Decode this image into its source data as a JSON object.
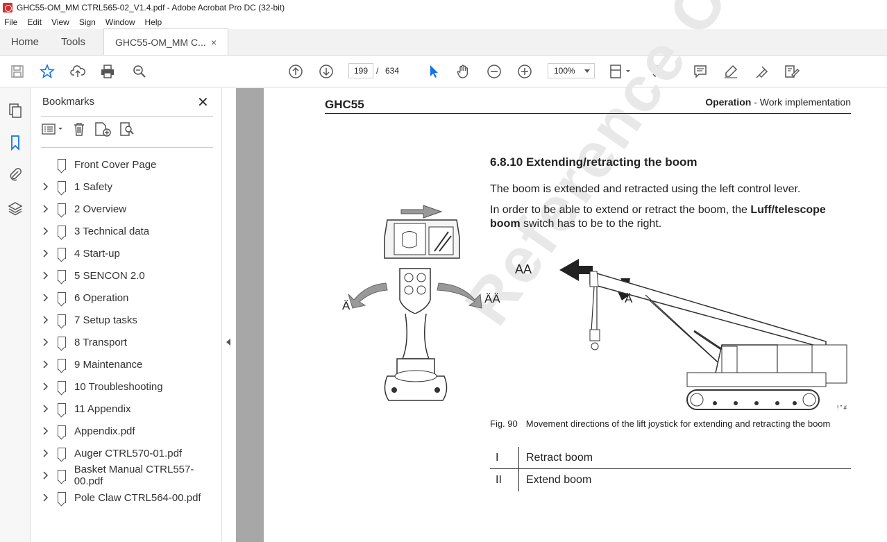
{
  "window": {
    "title": "GHC55-OM_MM CTRL565-02_V1.4.pdf - Adobe Acrobat Pro DC (32-bit)"
  },
  "menu": [
    "File",
    "Edit",
    "View",
    "Sign",
    "Window",
    "Help"
  ],
  "tabs": {
    "home": "Home",
    "tools": "Tools",
    "doc": "GHC55-OM_MM C...",
    "close": "×"
  },
  "toolbar": {
    "page_current": "199",
    "page_sep": "/",
    "page_total": "634",
    "zoom": "100%"
  },
  "bookmarks": {
    "title": "Bookmarks",
    "close": "✕",
    "items": [
      {
        "label": "Front Cover Page",
        "expandable": false
      },
      {
        "label": "1 Safety",
        "expandable": true
      },
      {
        "label": "2 Overview",
        "expandable": true
      },
      {
        "label": "3 Technical data",
        "expandable": true
      },
      {
        "label": "4 Start-up",
        "expandable": true
      },
      {
        "label": "5 SENCON 2.0",
        "expandable": true
      },
      {
        "label": "6 Operation",
        "expandable": true
      },
      {
        "label": "7 Setup tasks",
        "expandable": true
      },
      {
        "label": "8 Transport",
        "expandable": true
      },
      {
        "label": "9 Maintenance",
        "expandable": true
      },
      {
        "label": "10 Troubleshooting",
        "expandable": true
      },
      {
        "label": "11 Appendix",
        "expandable": true
      },
      {
        "label": " Appendix.pdf",
        "expandable": true
      },
      {
        "label": "Auger CTRL570-01.pdf",
        "expandable": true
      },
      {
        "label": "Basket Manual CTRL557-00.pdf",
        "expandable": true
      },
      {
        "label": "Pole Claw CTRL564-00.pdf",
        "expandable": true
      }
    ]
  },
  "document": {
    "header_left": "GHC55",
    "header_right_bold": "Operation",
    "header_right_rest": " - Work implementation",
    "section": "6.8.10 Extending/retracting the boom",
    "para1": "The boom is extended and retracted using the left control lever.",
    "para2_a": "In order to be able to extend or retract the boom, the ",
    "para2_bold": "Luff/telescope boom",
    "para2_b": " switch has to be to the right.",
    "fig_labels": {
      "left": "Ä",
      "right": "ÄÄ",
      "crane_aa": "AA",
      "crane_a": "Ä",
      "code": "! \" #"
    },
    "caption_num": "Fig. 90",
    "caption_text": "Movement directions of the lift joystick for extending and retracting the boom",
    "table": [
      {
        "num": "I",
        "text": "Retract boom"
      },
      {
        "num": "II",
        "text": "Extend boom"
      }
    ],
    "watermark": "Reference Only"
  }
}
